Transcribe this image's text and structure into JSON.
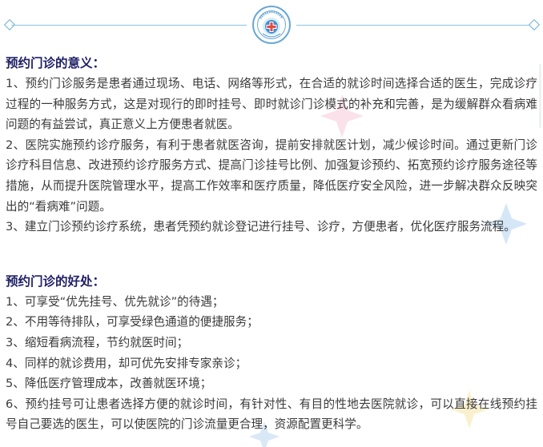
{
  "header": {
    "logo_icon": "hospital-seal-icon",
    "accent_color": "#8cc4de"
  },
  "section1": {
    "title": "预约门诊的意义：",
    "items": [
      "1、预约门诊服务是患者通过现场、电话、网络等形式，在合适的就诊时间选择合适的医生，完成诊疗过程的一种服务方式，这是对现行的即时挂号、即时就诊门诊模式的补充和完善，是为缓解群众看病难问题的有益尝试，真正意义上方便患者就医。",
      "2、医院实施预约诊疗服务，有利于患者就医咨询，提前安排就医计划，减少候诊时间。通过更新门诊诊疗科目信息、改进预约诊疗服务方式、提高门诊挂号比例、加强复诊预约、拓宽预约诊疗服务途径等措施，从而提升医院管理水平，提高工作效率和医疗质量，降低医疗安全风险，进一步解决群众反映突出的“看病难”问题。",
      "3、建立门诊预约诊疗系统，患者凭预约就诊登记进行挂号、诊疗，方便患者，优化医疗服务流程。"
    ]
  },
  "section2": {
    "title": "预约门诊的好处：",
    "items": [
      "1、可享受“优先挂号、优先就诊”的待遇；",
      "2、不用等待排队，可享受绿色通道的便捷服务；",
      "3、缩短看病流程，节约就医时间；",
      "4、同样的就诊费用，却可优先安排专家亲诊；",
      "5、降低医疗管理成本，改善就医环境；",
      "6、预约挂号可让患者选择方便的就诊时间，有针对性、有目的性地去医院就诊，可以直接在线预约挂号自己要选的医生，可以使医院的门诊流量更合理，资源配置更科学。"
    ]
  }
}
